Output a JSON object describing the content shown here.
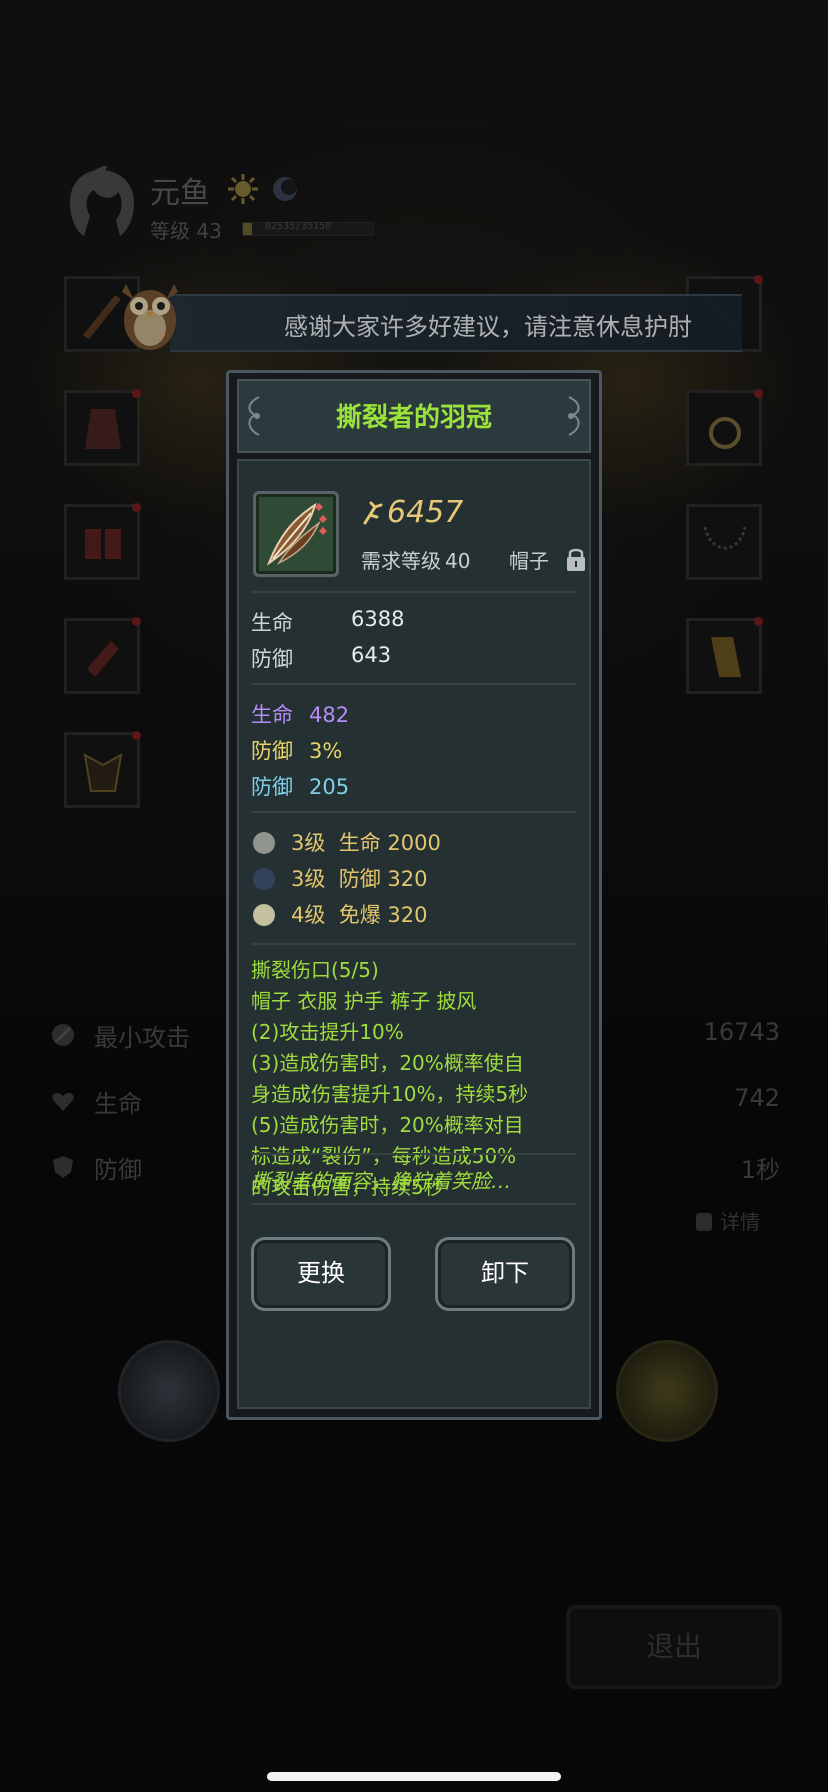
{
  "player": {
    "name": "元鱼",
    "level_text": "等级 43",
    "xp_text": "02535/35150",
    "xp_fraction": 0.07
  },
  "notice_banner": {
    "text": "感谢大家许多好建议，请注意休息护肘"
  },
  "stats": [
    {
      "label": "最小攻击",
      "value": "16743"
    },
    {
      "label": "生命",
      "value": "742"
    },
    {
      "label": "防御",
      "value": "1秒"
    }
  ],
  "details_label": "详情",
  "exit_label": "退出",
  "item": {
    "name": "撕裂者的羽冠",
    "power": "6457",
    "requirement_label": "需求等级",
    "requirement_level": "40",
    "slot_type": "帽子",
    "base_stats": [
      {
        "label": "生命",
        "value": "6388"
      },
      {
        "label": "防御",
        "value": "643"
      }
    ],
    "bonus_stats": [
      {
        "label": "生命",
        "value": "482",
        "color": "#b48cf5"
      },
      {
        "label": "防御",
        "value": "3%",
        "color": "#e8d36a"
      },
      {
        "label": "防御",
        "value": "205",
        "color": "#7fd0e6"
      }
    ],
    "gems": [
      {
        "level": "3级",
        "effect": "生命 2000",
        "color": "#9aa09a"
      },
      {
        "level": "3级",
        "effect": "防御 320",
        "color": "#3d4d66"
      },
      {
        "level": "4级",
        "effect": "免爆 320",
        "color": "#c9c6a6"
      }
    ],
    "set_bonus": {
      "title": "撕裂伤口(5/5)",
      "pieces": "帽子 衣服 护手 裤子 披风",
      "bonus2": "(2)攻击提升10%",
      "bonus3_a": "(3)造成伤害时，20%概率使自",
      "bonus3_b": "身造成伤害提升10%，持续5秒",
      "bonus5_a": "(5)造成伤害时，20%概率对目",
      "bonus5_b": "标造成“裂伤”，每秒造成50%",
      "bonus5_c": "的攻击伤害，持续5秒"
    },
    "flavor": "撕裂者的面容，狰狞着笑脸…",
    "buttons": {
      "replace": "更换",
      "unequip": "卸下"
    }
  }
}
